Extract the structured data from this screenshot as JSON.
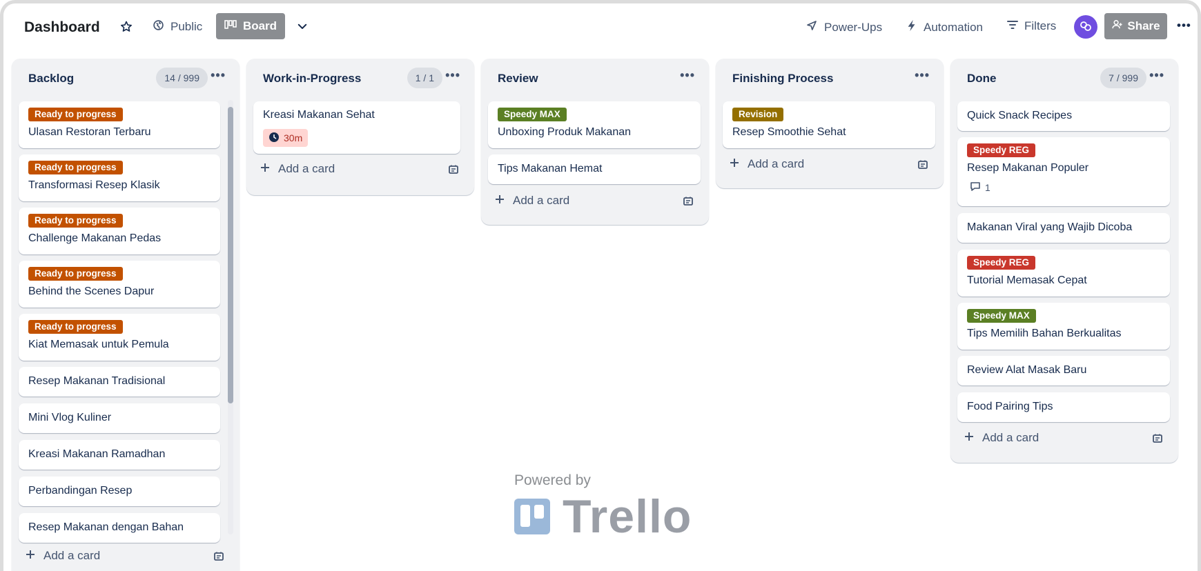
{
  "header": {
    "title": "Dashboard",
    "visibility": "Public",
    "view": "Board",
    "powerups": "Power-Ups",
    "automation": "Automation",
    "filters": "Filters",
    "share": "Share"
  },
  "lists": [
    {
      "title": "Backlog",
      "count": "14 / 999",
      "add_card": "Add a card",
      "cards": [
        {
          "label": "Ready to progress",
          "label_color": "#c25100",
          "text": "Ulasan Restoran Terbaru"
        },
        {
          "label": "Ready to progress",
          "label_color": "#c25100",
          "text": "Transformasi Resep Klasik"
        },
        {
          "label": "Ready to progress",
          "label_color": "#c25100",
          "text": "Challenge Makanan Pedas"
        },
        {
          "label": "Ready to progress",
          "label_color": "#c25100",
          "text": "Behind the Scenes Dapur"
        },
        {
          "label": "Ready to progress",
          "label_color": "#c25100",
          "text": "Kiat Memasak untuk Pemula"
        },
        {
          "text": "Resep Makanan Tradisional"
        },
        {
          "text": "Mini Vlog Kuliner"
        },
        {
          "text": "Kreasi Makanan Ramadhan"
        },
        {
          "text": "Perbandingan Resep"
        },
        {
          "text": "Resep Makanan dengan Bahan"
        }
      ]
    },
    {
      "title": "Work-in-Progress",
      "count": "1 / 1",
      "add_card": "Add a card",
      "cards": [
        {
          "text": "Kreasi Makanan Sehat",
          "time_badge": "30m"
        }
      ]
    },
    {
      "title": "Review",
      "add_card": "Add a card",
      "cards": [
        {
          "label": "Speedy MAX",
          "label_color": "#5b7f24",
          "text": "Unboxing Produk Makanan"
        },
        {
          "text": "Tips Makanan Hemat"
        }
      ]
    },
    {
      "title": "Finishing Process",
      "add_card": "Add a card",
      "cards": [
        {
          "label": "Revision",
          "label_color": "#946f00",
          "text": "Resep Smoothie Sehat"
        }
      ]
    },
    {
      "title": "Done",
      "count": "7 / 999",
      "add_card": "Add a card",
      "cards": [
        {
          "text": "Quick Snack Recipes"
        },
        {
          "label": "Speedy REG",
          "label_color": "#c9372c",
          "text": "Resep Makanan Populer",
          "comments": "1"
        },
        {
          "text": "Makanan Viral yang Wajib Dicoba"
        },
        {
          "label": "Speedy REG",
          "label_color": "#c9372c",
          "text": "Tutorial Memasak Cepat"
        },
        {
          "label": "Speedy MAX",
          "label_color": "#5b7f24",
          "text": "Tips Memilih Bahan Berkualitas"
        },
        {
          "text": "Review Alat Masak Baru"
        },
        {
          "text": "Food Pairing Tips"
        }
      ]
    }
  ],
  "footer": {
    "powered_by": "Powered by",
    "brand": "Trello"
  }
}
